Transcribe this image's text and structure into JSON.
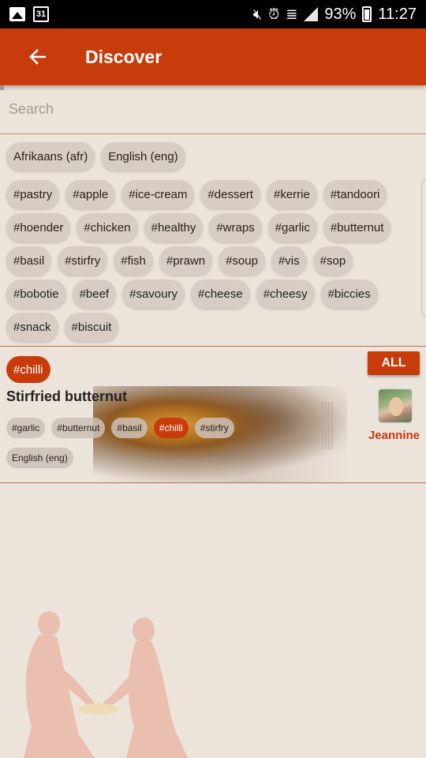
{
  "status_bar": {
    "battery": "93%",
    "time": "11:27",
    "calendar_day": "31"
  },
  "header": {
    "title": "Discover"
  },
  "search": {
    "placeholder": "Search"
  },
  "language_tags": [
    "Afrikaans (afr)",
    "English (eng)"
  ],
  "hashtags": [
    "#pastry",
    "#apple",
    "#ice-cream",
    "#dessert",
    "#kerrie",
    "#tandoori",
    "#hoender",
    "#chicken",
    "#healthy",
    "#wraps",
    "#garlic",
    "#butternut",
    "#basil",
    "#stirfry",
    "#fish",
    "#prawn",
    "#soup",
    "#vis",
    "#sop",
    "#bobotie",
    "#beef",
    "#savoury",
    "#cheese",
    "#cheesy",
    "#biccies",
    "#snack",
    "#biscuit"
  ],
  "filter": {
    "active_tag": "#chilli",
    "all_label": "ALL"
  },
  "recipe": {
    "title": "Stirfried butternut",
    "tags": [
      "#garlic",
      "#butternut",
      "#basil",
      "#chilli",
      "#stirfry"
    ],
    "active_tag": "#chilli",
    "language": "English (eng)",
    "author": "Jeannine"
  },
  "colors": {
    "brand": "#c83b0b",
    "background": "#ece3da",
    "chip": "#d8cdc4"
  }
}
